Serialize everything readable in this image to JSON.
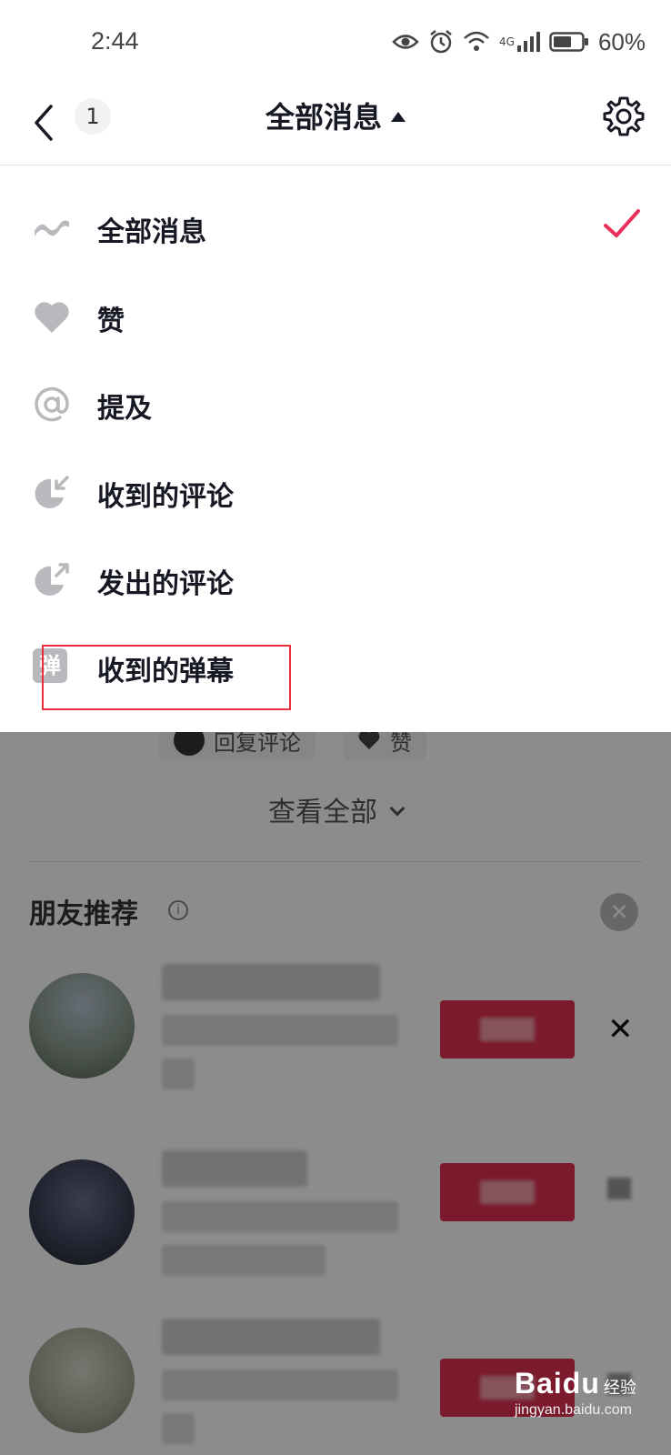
{
  "status_bar": {
    "time": "2:44",
    "network_label": "4G",
    "battery": "60%"
  },
  "header": {
    "count": "1",
    "title": "全部消息"
  },
  "menu": {
    "items": [
      {
        "label": "全部消息",
        "icon": "all-messages-icon",
        "selected": true
      },
      {
        "label": "赞",
        "icon": "heart-icon",
        "selected": false
      },
      {
        "label": "提及",
        "icon": "at-icon",
        "selected": false
      },
      {
        "label": "收到的评论",
        "icon": "received-comment-icon",
        "selected": false
      },
      {
        "label": "发出的评论",
        "icon": "sent-comment-icon",
        "selected": false
      },
      {
        "label": "收到的弹幕",
        "icon": "danmu-icon",
        "icon_text": "弹",
        "selected": false
      }
    ],
    "check_color": "#e8305a"
  },
  "background": {
    "reply_chip": "回复评论",
    "like_chip": "赞",
    "view_all": "查看全部",
    "recommend_title": "朋友推荐",
    "close_symbol": "✕",
    "dismiss_symbol": "✕"
  },
  "watermark": {
    "brand": "Baidu",
    "sub": "经验",
    "url": "jingyan.baidu.com"
  },
  "colors": {
    "accent": "#e03050",
    "highlight_box": "#e8303a"
  }
}
